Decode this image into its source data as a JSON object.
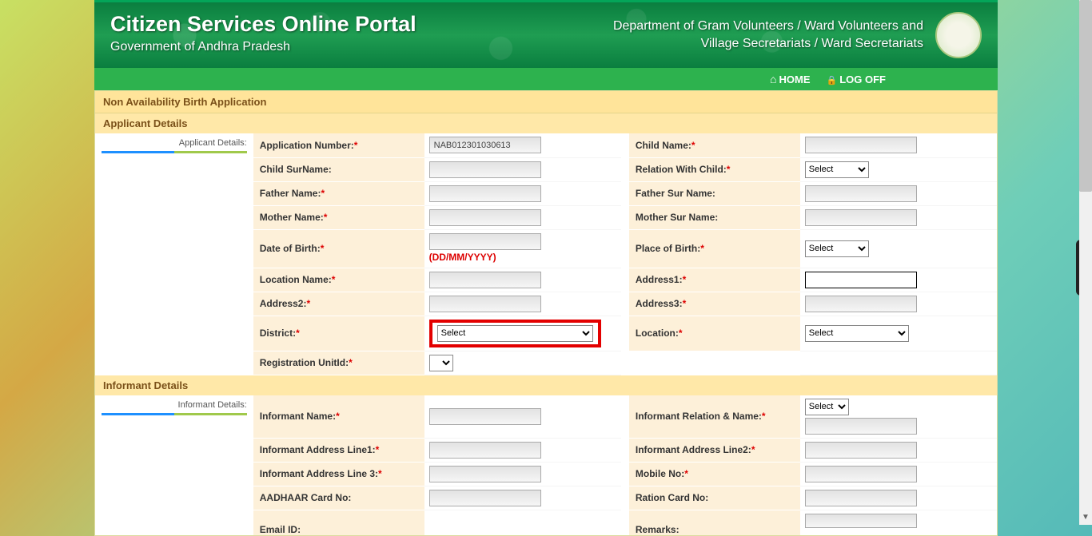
{
  "banner": {
    "title": "Citizen Services Online Portal",
    "subtitle": "Government of Andhra Pradesh",
    "dept_line1": "Department of Gram Volunteers / Ward Volunteers and",
    "dept_line2": "Village Secretariats / Ward Secretariats"
  },
  "nav": {
    "home": "HOME",
    "logoff": "LOG OFF"
  },
  "page_title": "Non Availability Birth Application",
  "applicant": {
    "section": "Applicant Details",
    "side_label": "Applicant Details:",
    "app_number_label": "Application Number:",
    "app_number_value": "NAB012301030613",
    "child_name_label": "Child Name:",
    "child_surname_label": "Child SurName:",
    "relation_label": "Relation With Child:",
    "relation_value": "Select",
    "father_name_label": "Father Name:",
    "father_surname_label": "Father Sur Name:",
    "mother_name_label": "Mother Name:",
    "mother_surname_label": "Mother Sur Name:",
    "dob_label": "Date of Birth:",
    "dob_hint": "(DD/MM/YYYY)",
    "pob_label": "Place of Birth:",
    "pob_value": "Select",
    "location_name_label": "Location Name:",
    "address1_label": "Address1:",
    "address2_label": "Address2:",
    "address3_label": "Address3:",
    "district_label": "District:",
    "district_value": "Select",
    "location_label": "Location:",
    "location_value": "Select",
    "reg_unit_label": "Registration UnitId:"
  },
  "informant": {
    "section": "Informant Details",
    "side_label": "Informant Details:",
    "name_label": "Informant Name:",
    "relation_label": "Informant Relation & Name:",
    "relation_value": "Select",
    "addr1_label": "Informant Address Line1:",
    "addr2_label": "Informant Address Line2:",
    "addr3_label": "Informant Address Line 3:",
    "mobile_label": "Mobile No:",
    "aadhaar_label": "AADHAAR Card No:",
    "ration_label": "Ration Card No:",
    "email_label": "Email ID:",
    "remarks_label": "Remarks:"
  }
}
